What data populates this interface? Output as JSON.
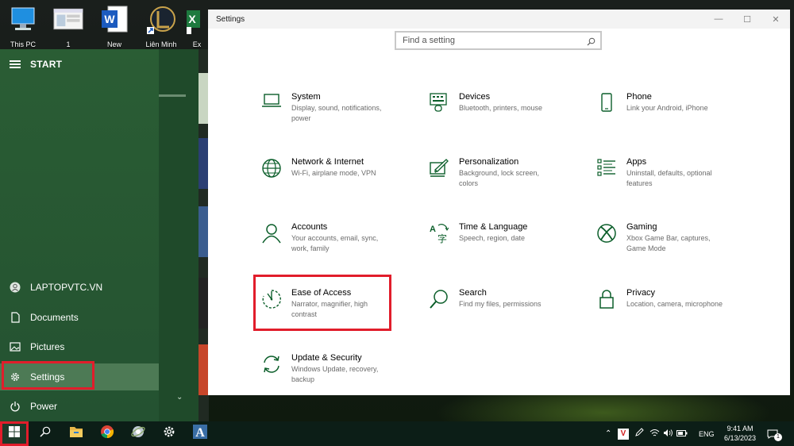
{
  "desktop": {
    "icons": [
      {
        "label": "This PC",
        "icon": "computer-icon"
      },
      {
        "label": "1",
        "icon": "window-icon"
      },
      {
        "label": "New",
        "icon": "word-icon"
      },
      {
        "label": "Liên Minh",
        "icon": "league-icon"
      },
      {
        "label": "Ex",
        "icon": "excel-icon"
      }
    ]
  },
  "start_menu": {
    "title": "START",
    "items": [
      {
        "label": "LAPTOPVTC.VN",
        "icon": "user-icon"
      },
      {
        "label": "Documents",
        "icon": "document-icon"
      },
      {
        "label": "Pictures",
        "icon": "pictures-icon"
      },
      {
        "label": "Settings",
        "icon": "gear-icon"
      },
      {
        "label": "Power",
        "icon": "power-icon"
      }
    ]
  },
  "settings": {
    "title": "Settings",
    "search_placeholder": "Find a setting",
    "categories": [
      {
        "name": "System",
        "desc": "Display, sound, notifications, power",
        "icon": "laptop-icon"
      },
      {
        "name": "Devices",
        "desc": "Bluetooth, printers, mouse",
        "icon": "keyboard-icon"
      },
      {
        "name": "Phone",
        "desc": "Link your Android, iPhone",
        "icon": "phone-icon"
      },
      {
        "name": "Network & Internet",
        "desc": "Wi-Fi, airplane mode, VPN",
        "icon": "globe-icon"
      },
      {
        "name": "Personalization",
        "desc": "Background, lock screen, colors",
        "icon": "paint-icon"
      },
      {
        "name": "Apps",
        "desc": "Uninstall, defaults, optional features",
        "icon": "apps-list-icon"
      },
      {
        "name": "Accounts",
        "desc": "Your accounts, email, sync, work, family",
        "icon": "person-icon"
      },
      {
        "name": "Time & Language",
        "desc": "Speech, region, date",
        "icon": "language-icon"
      },
      {
        "name": "Gaming",
        "desc": "Xbox Game Bar, captures, Game Mode",
        "icon": "xbox-icon"
      },
      {
        "name": "Ease of Access",
        "desc": "Narrator, magnifier, high contrast",
        "icon": "ease-of-access-icon"
      },
      {
        "name": "Search",
        "desc": "Find my files, permissions",
        "icon": "search-icon"
      },
      {
        "name": "Privacy",
        "desc": "Location, camera, microphone",
        "icon": "lock-icon"
      },
      {
        "name": "Update & Security",
        "desc": "Windows Update, recovery, backup",
        "icon": "sync-icon"
      }
    ]
  },
  "taskbar": {
    "apps": [
      "windows-start-icon",
      "search-icon",
      "file-explorer-icon",
      "chrome-icon",
      "browser-icon",
      "gear-icon",
      "font-app-icon"
    ],
    "tray": {
      "keyboard_badge": "V",
      "language": "ENG",
      "time": "9:41 AM",
      "date": "6/13/2023",
      "notification_count": "1"
    }
  },
  "colors": {
    "accent": "#0b5e2a",
    "highlight": "#e11d2b",
    "start_bg": "#245231",
    "taskbar_bg": "#0c1e17"
  }
}
